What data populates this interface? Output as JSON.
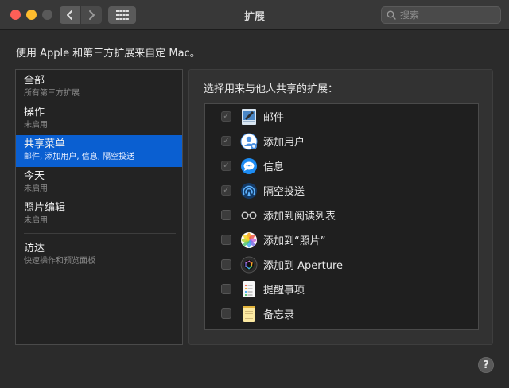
{
  "window": {
    "title": "扩展",
    "search_placeholder": "搜索"
  },
  "subtitle": "使用 Apple 和第三方扩展来自定 Mac。",
  "sidebar": {
    "items": [
      {
        "title": "全部",
        "subtitle": "所有第三方扩展"
      },
      {
        "title": "操作",
        "subtitle": "未启用"
      },
      {
        "title": "共享菜单",
        "subtitle": "邮件, 添加用户, 信息, 隔空投送",
        "selected": true
      },
      {
        "title": "今天",
        "subtitle": "未启用"
      },
      {
        "title": "照片编辑",
        "subtitle": "未启用"
      },
      {
        "title": "访达",
        "subtitle": "快速操作和预览面板"
      }
    ]
  },
  "panel": {
    "label": "选择用来与他人共享的扩展：",
    "extensions": [
      {
        "name": "邮件",
        "checked": true,
        "icon": "mail-icon"
      },
      {
        "name": "添加用户",
        "checked": true,
        "icon": "add-people-icon"
      },
      {
        "name": "信息",
        "checked": true,
        "icon": "messages-icon"
      },
      {
        "name": "隔空投送",
        "checked": true,
        "icon": "airdrop-icon"
      },
      {
        "name": "添加到阅读列表",
        "checked": false,
        "icon": "reading-list-icon"
      },
      {
        "name": "添加到“照片”",
        "checked": false,
        "icon": "photos-icon"
      },
      {
        "name": "添加到 Aperture",
        "checked": false,
        "icon": "aperture-icon"
      },
      {
        "name": "提醒事项",
        "checked": false,
        "icon": "reminders-icon"
      },
      {
        "name": "备忘录",
        "checked": false,
        "icon": "notes-icon"
      }
    ]
  },
  "help_label": "?",
  "colors": {
    "accent": "#0a5fd1",
    "background": "#2b2b2b"
  }
}
